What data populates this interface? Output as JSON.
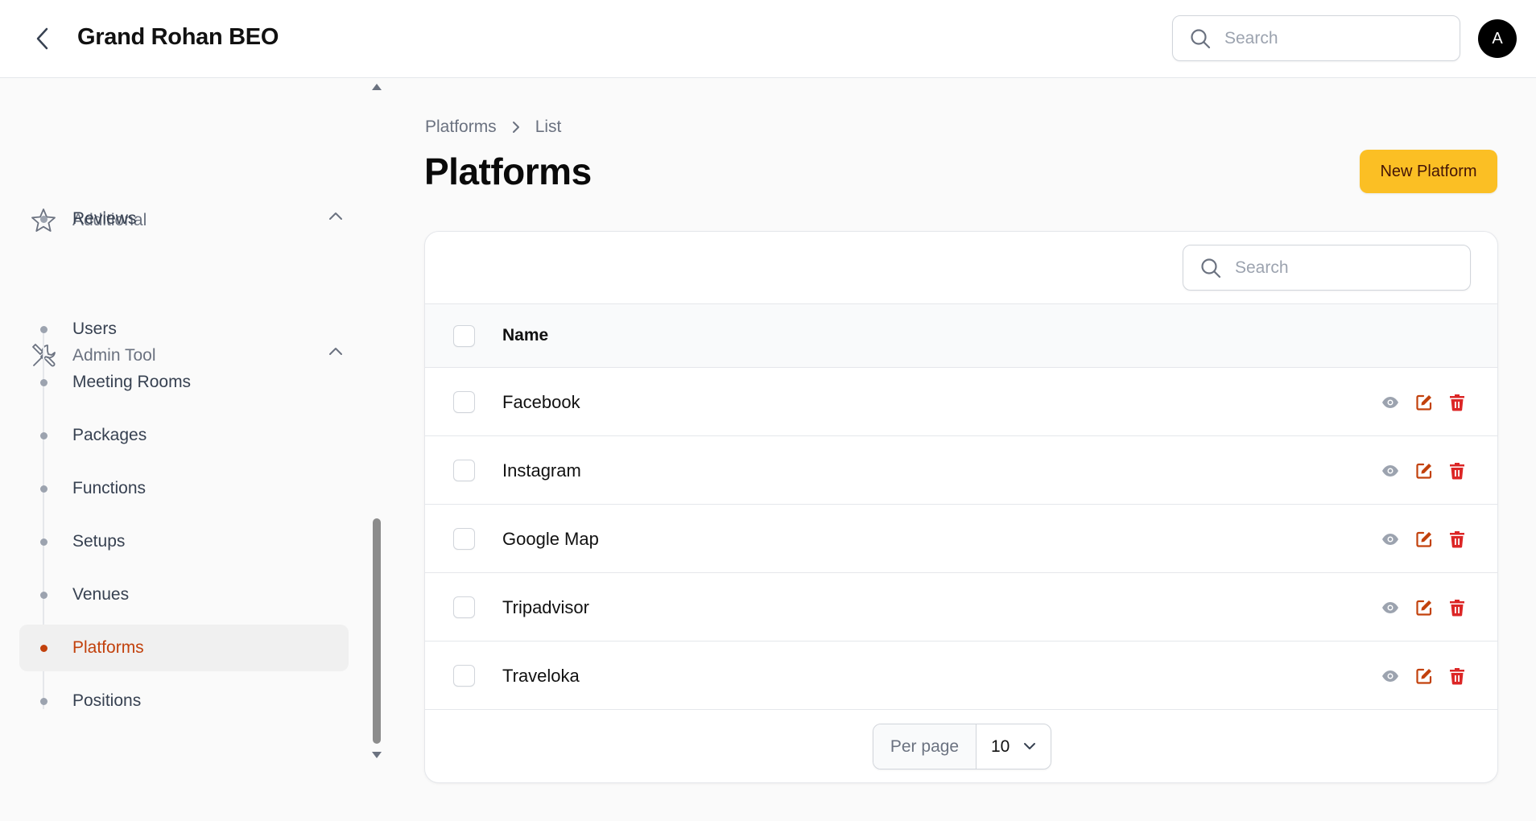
{
  "header": {
    "title": "Grand Rohan BEO",
    "search_placeholder": "Search",
    "avatar_initial": "A"
  },
  "sidebar": {
    "groups": [
      {
        "label": "Additional",
        "icon": "star-icon",
        "items": [
          {
            "label": "Reviews"
          }
        ]
      },
      {
        "label": "Admin Tool",
        "icon": "tools-icon",
        "items": [
          {
            "label": "Users"
          },
          {
            "label": "Meeting Rooms"
          },
          {
            "label": "Packages"
          },
          {
            "label": "Functions"
          },
          {
            "label": "Setups"
          },
          {
            "label": "Venues"
          },
          {
            "label": "Platforms",
            "active": true
          },
          {
            "label": "Positions"
          }
        ]
      }
    ]
  },
  "breadcrumb": {
    "parent": "Platforms",
    "current": "List"
  },
  "page": {
    "title": "Platforms",
    "new_button": "New Platform"
  },
  "table": {
    "search_placeholder": "Search",
    "columns": [
      "Name"
    ],
    "rows": [
      {
        "name": "Facebook"
      },
      {
        "name": "Instagram"
      },
      {
        "name": "Google Map"
      },
      {
        "name": "Tripadvisor"
      },
      {
        "name": "Traveloka"
      }
    ],
    "actions": [
      "view-icon",
      "edit-icon",
      "delete-icon"
    ]
  },
  "pagination": {
    "per_page_label": "Per page",
    "per_page_value": "10"
  },
  "colors": {
    "accent": "#fbbf24",
    "active_nav": "#c2410c",
    "edit": "#c2410c",
    "delete": "#dc2626"
  }
}
